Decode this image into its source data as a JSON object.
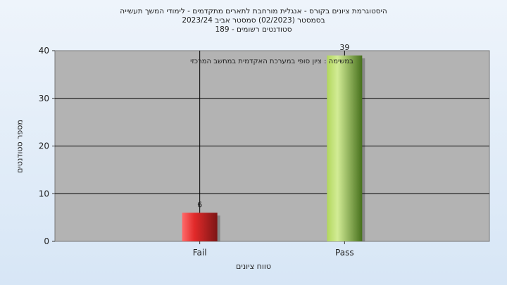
{
  "chart_data": {
    "type": "bar",
    "title_lines": [
      "היסטוגרמת ציונים בקורס - אנגלית מורחבת לתארים מתקדמים - לימודי המשך תעשייה",
      "בסמסטר  (02/2023)  סמסטר אביב 2023/24",
      "סטודנטים רשומים - 189"
    ],
    "categories": [
      "Fail",
      "Pass"
    ],
    "values": [
      6,
      39
    ],
    "data_labels": [
      "6",
      "39"
    ],
    "annotation": "במשימה : ציון סופי במערכת האקדמית במחשב המרכזי",
    "xlabel": "טווח ציונים",
    "ylabel": "מספר סטודנטים",
    "ylim": [
      0,
      40
    ],
    "yticks": [
      0,
      10,
      20,
      30,
      40
    ],
    "grid": true,
    "legend": "none",
    "colors": {
      "plot_bg": "#b3b3b3",
      "fail_light": "#ff5a5a",
      "fail_dark": "#8a1a1a",
      "pass_light": "#cde88a",
      "pass_dark": "#4d7a1f"
    }
  }
}
